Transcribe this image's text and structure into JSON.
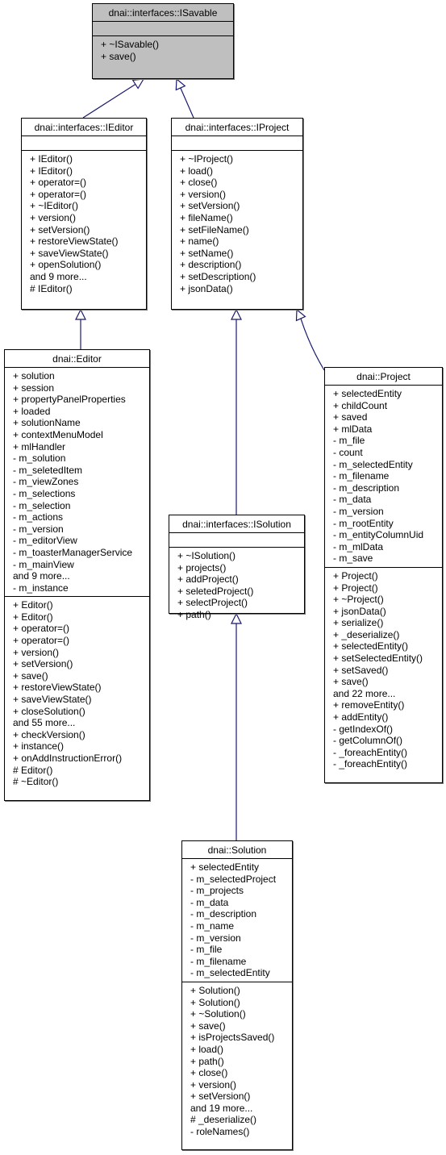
{
  "diagram": {
    "type": "class-inheritance",
    "classes": [
      {
        "id": "isavable",
        "name": "dnai::interfaces::ISavable",
        "highlighted": true,
        "attributes": [],
        "methods": [
          "+ ~ISavable()",
          "+ save()"
        ]
      },
      {
        "id": "ieditor",
        "name": "dnai::interfaces::IEditor",
        "highlighted": false,
        "attributes": [],
        "methods": [
          "+ IEditor()",
          "+ IEditor()",
          "+ operator=()",
          "+ operator=()",
          "+ ~IEditor()",
          "+ version()",
          "+ setVersion()",
          "+ restoreViewState()",
          "+ saveViewState()",
          "+ openSolution()",
          "and 9 more...",
          "# IEditor()"
        ]
      },
      {
        "id": "iproject",
        "name": "dnai::interfaces::IProject",
        "highlighted": false,
        "attributes": [],
        "methods": [
          "+ ~IProject()",
          "+ load()",
          "+ close()",
          "+ version()",
          "+ setVersion()",
          "+ fileName()",
          "+ setFileName()",
          "+ name()",
          "+ setName()",
          "+ description()",
          "+ setDescription()",
          "+ jsonData()"
        ]
      },
      {
        "id": "editor",
        "name": "dnai::Editor",
        "highlighted": false,
        "attributes": [
          "+ solution",
          "+ session",
          "+ propertyPanelProperties",
          "+ loaded",
          "+ solutionName",
          "+ contextMenuModel",
          "+ mlHandler",
          "- m_solution",
          "- m_seletedItem",
          "- m_viewZones",
          "- m_selections",
          "- m_selection",
          "- m_actions",
          "- m_version",
          "- m_editorView",
          "- m_toasterManagerService",
          "- m_mainView",
          "and 9 more...",
          "- m_instance"
        ],
        "methods": [
          "+ Editor()",
          "+ Editor()",
          "+ operator=()",
          "+ operator=()",
          "+ version()",
          "+ setVersion()",
          "+ save()",
          "+ restoreViewState()",
          "+ saveViewState()",
          "+ closeSolution()",
          "and 55 more...",
          "+ checkVersion()",
          "+ instance()",
          "+ onAddInstructionError()",
          "# Editor()",
          "# ~Editor()"
        ]
      },
      {
        "id": "project",
        "name": "dnai::Project",
        "highlighted": false,
        "attributes": [
          "+ selectedEntity",
          "+ childCount",
          "+ saved",
          "+ mlData",
          "- m_file",
          "- count",
          "- m_selectedEntity",
          "- m_filename",
          "- m_description",
          "- m_data",
          "- m_version",
          "- m_rootEntity",
          "- m_entityColumnUid",
          "- m_mlData",
          "- m_save"
        ],
        "methods": [
          "+ Project()",
          "+ Project()",
          "+ ~Project()",
          "+ jsonData()",
          "+ serialize()",
          "+ _deserialize()",
          "+ selectedEntity()",
          "+ setSelectedEntity()",
          "+ setSaved()",
          "+ save()",
          "and 22 more...",
          "+ removeEntity()",
          "+ addEntity()",
          "- getIndexOf()",
          "- getColumnOf()",
          "- _foreachEntity()",
          "- _foreachEntity()"
        ]
      },
      {
        "id": "isolution",
        "name": "dnai::interfaces::ISolution",
        "highlighted": false,
        "attributes": [],
        "methods": [
          "+ ~ISolution()",
          "+ projects()",
          "+ addProject()",
          "+ seletedProject()",
          "+ selectProject()",
          "+ path()"
        ]
      },
      {
        "id": "solution",
        "name": "dnai::Solution",
        "highlighted": false,
        "attributes": [
          "+ selectedEntity",
          "- m_selectedProject",
          "- m_projects",
          "- m_data",
          "- m_description",
          "- m_name",
          "- m_version",
          "- m_file",
          "- m_filename",
          "- m_selectedEntity"
        ],
        "methods": [
          "+ Solution()",
          "+ Solution()",
          "+ ~Solution()",
          "+ save()",
          "+ isProjectsSaved()",
          "+ load()",
          "+ path()",
          "+ close()",
          "+ version()",
          "+ setVersion()",
          "and 19 more...",
          "# _deserialize()",
          "- roleNames()"
        ]
      }
    ],
    "inheritance": [
      {
        "from": "ieditor",
        "to": "isavable"
      },
      {
        "from": "iproject",
        "to": "isavable"
      },
      {
        "from": "editor",
        "to": "ieditor"
      },
      {
        "from": "isolution",
        "to": "iproject"
      },
      {
        "from": "project",
        "to": "iproject"
      },
      {
        "from": "solution",
        "to": "isolution"
      }
    ],
    "colors": {
      "edge": "#191970",
      "highlight_fill": "#bfbfbf",
      "box_fill": "#ffffff",
      "border": "#000000"
    }
  }
}
